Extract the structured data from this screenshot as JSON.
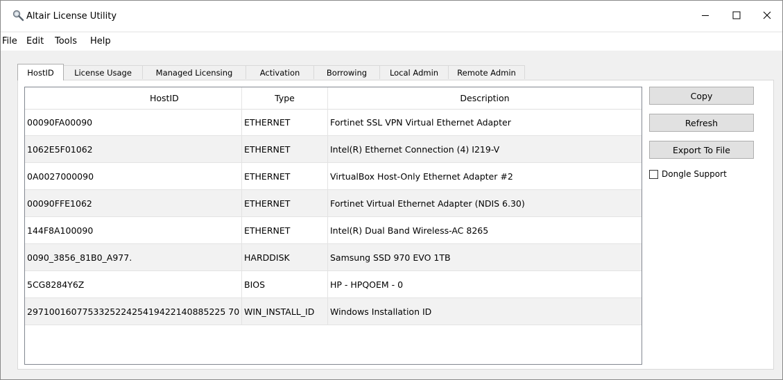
{
  "window": {
    "title": "Altair License Utility"
  },
  "menu": [
    "File",
    "Edit",
    "Tools",
    "Help"
  ],
  "tabs": [
    "HostID",
    "License Usage",
    "Managed Licensing",
    "Activation",
    "Borrowing",
    "Local Admin",
    "Remote Admin"
  ],
  "active_tab": "HostID",
  "table": {
    "columns": [
      "HostID",
      "Type",
      "Description"
    ],
    "rows": [
      [
        "00090FA00090",
        "ETHERNET",
        "Fortinet SSL VPN Virtual Ethernet Adapter"
      ],
      [
        "1062E5F01062",
        "ETHERNET",
        "Intel(R) Ethernet Connection (4) I219-V"
      ],
      [
        "0A0027000090",
        "ETHERNET",
        "VirtualBox Host-Only Ethernet Adapter #2"
      ],
      [
        "00090FFE1062",
        "ETHERNET",
        "Fortinet Virtual Ethernet Adapter (NDIS 6.30)"
      ],
      [
        "144F8A100090",
        "ETHERNET",
        "Intel(R) Dual Band Wireless-AC 8265"
      ],
      [
        "0090_3856_81B0_A977.",
        "HARDDISK",
        "Samsung SSD 970 EVO 1TB"
      ],
      [
        "5CG8284Y6Z",
        "BIOS",
        "HP - HPQOEM - 0"
      ],
      [
        "297100160775332522425419422140885225 70",
        "WIN_INSTALL_ID",
        "Windows Installation ID"
      ]
    ]
  },
  "buttons": {
    "copy": "Copy",
    "refresh": "Refresh",
    "export": "Export To File"
  },
  "dongle_support": {
    "label": "Dongle Support",
    "checked": false
  },
  "icons": {
    "app": "magnifier-key-icon",
    "minimize": "minimize-icon",
    "maximize": "maximize-icon",
    "close": "close-icon"
  }
}
